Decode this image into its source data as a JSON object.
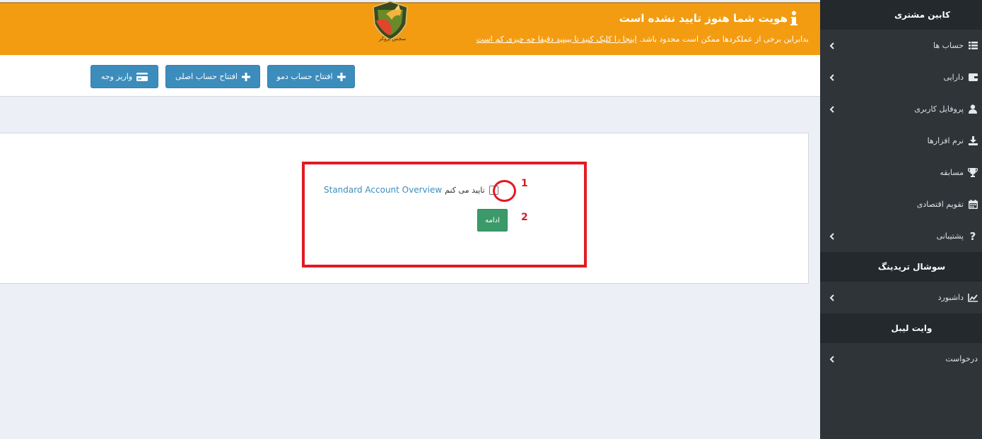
{
  "banner": {
    "title": "هویت شما هنوز تایید نشده است",
    "text": "بدابراین برخی از عملکردها ممکن است محدود باشد.",
    "link": "اینجا را کلیک کنید تا ببینید دقیقا چه چیزی کم است",
    "logo_caption": "سجس بروکر"
  },
  "toolbar": {
    "demo_account": "افتتاح حساب دمو",
    "real_account": "افتتاح حساب اصلی",
    "deposit": "واریز وجه"
  },
  "sidebar": {
    "header": "کابین مشتری",
    "items": [
      {
        "label": "حساب ها",
        "icon": "list-icon"
      },
      {
        "label": "دارایی",
        "icon": "wallet-icon"
      },
      {
        "label": "پروفایل کاربری",
        "icon": "user-icon"
      },
      {
        "label": "نرم افزارها",
        "icon": "download-icon"
      },
      {
        "label": "مسابقه",
        "icon": "trophy-icon"
      },
      {
        "label": "تقویم اقتصادی",
        "icon": "calendar-icon"
      },
      {
        "label": "پشتیبانی",
        "icon": "question-icon"
      }
    ],
    "social_header": "سوشال تریدینگ",
    "social_items": [
      {
        "label": "داشبورد",
        "icon": "chart-icon"
      }
    ],
    "white_label_header": "وایت لیبل",
    "white_label_items": [
      {
        "label": "درخواست"
      }
    ]
  },
  "agreement": {
    "confirm_text": "تایید می کنم",
    "link_text": "Standard Account Overview",
    "continue": "ادامه",
    "step1": "1",
    "step2": "2"
  },
  "colors": {
    "banner": "#f39c12",
    "sidebar": "#2f3439",
    "primary": "#3c8dbc",
    "success": "#3c9a6a",
    "annotation": "#e21a22"
  }
}
